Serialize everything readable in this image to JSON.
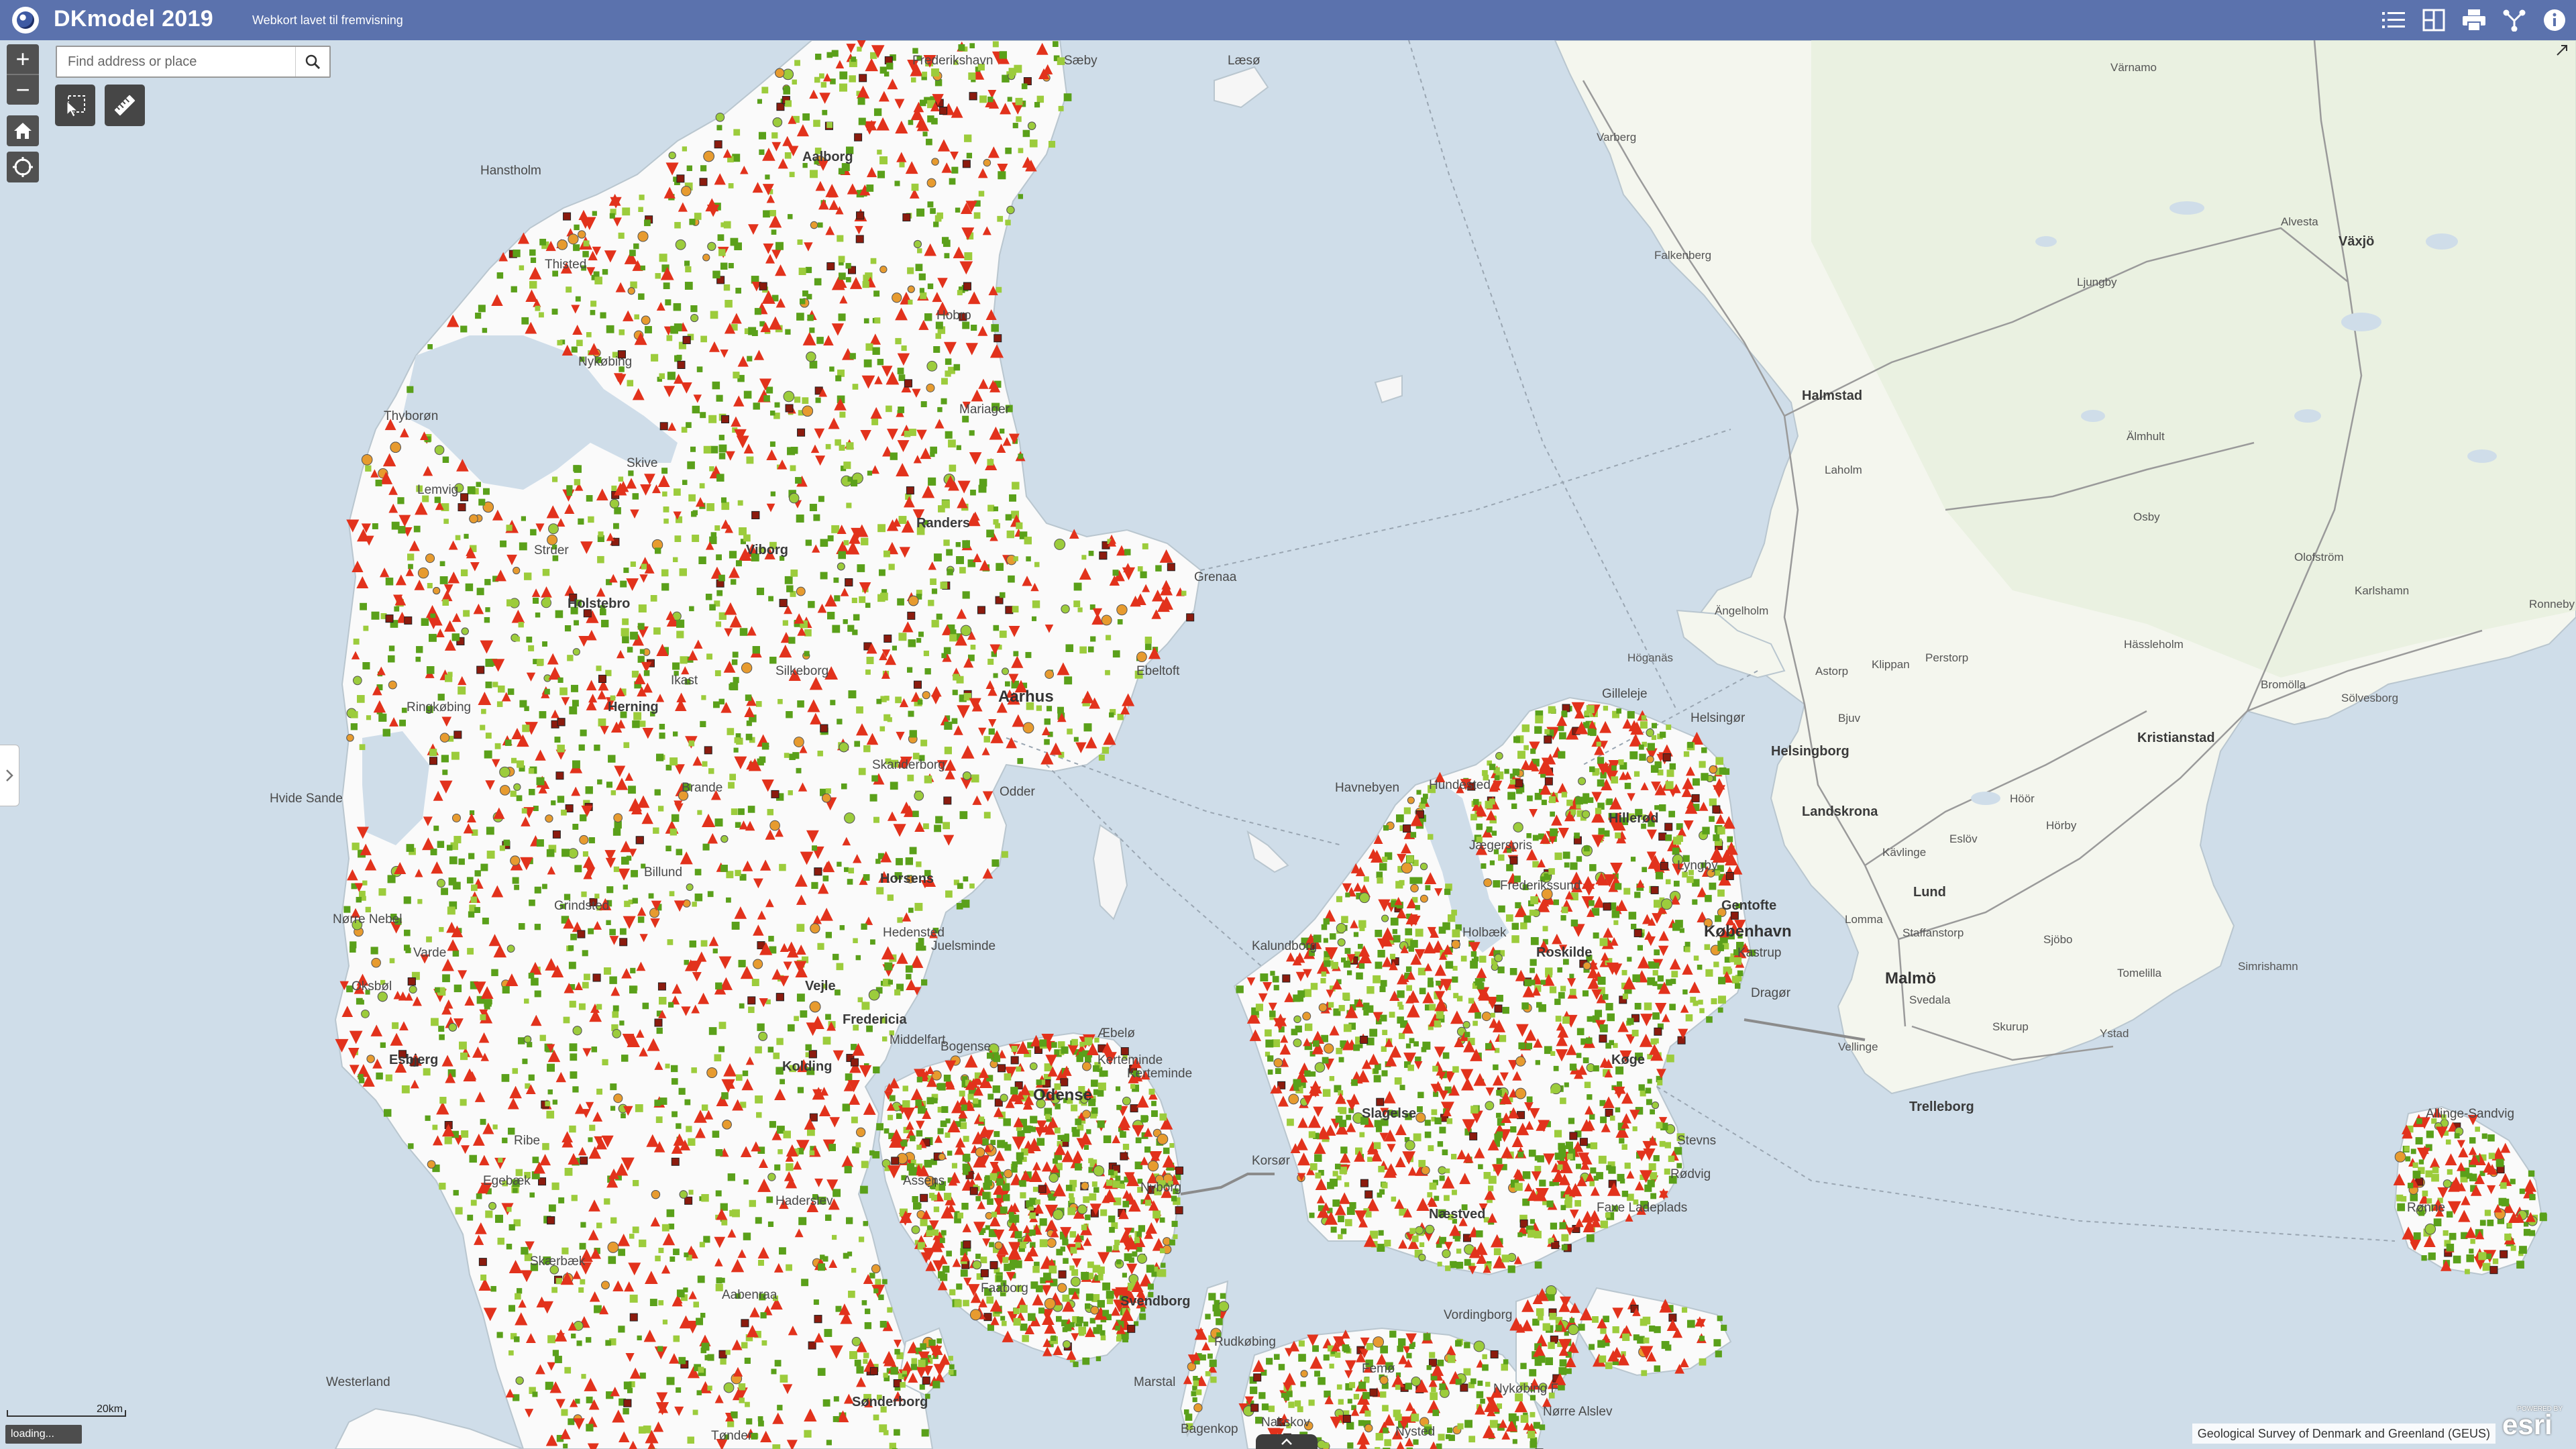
{
  "header": {
    "title": "DKmodel 2019",
    "subtitle": "Webkort lavet til fremvisning"
  },
  "header_icons": [
    "layer-list-icon",
    "basemap-gallery-icon",
    "print-icon",
    "share-icon",
    "about-icon"
  ],
  "controls": {
    "zoom_in": "+",
    "zoom_out": "−",
    "home_icon": "home-icon",
    "locate_icon": "locate-icon"
  },
  "search": {
    "placeholder": "Find address or place",
    "value": ""
  },
  "tools": [
    "select-tool-icon",
    "measure-tool-icon"
  ],
  "scale": {
    "label": "20km"
  },
  "status": {
    "loading": "loading..."
  },
  "attribution": "Geological Survey of Denmark and Greenland (GEUS)",
  "esri": {
    "logo": "esri",
    "powered": "POWERED BY"
  },
  "colors": {
    "header": "#5b72ad",
    "water": "#cfdde9",
    "land": "#fafafa",
    "sweden_land": "#f4f6ef",
    "symbol_green": "#5aa01a",
    "symbol_lightgreen": "#9ccc3c",
    "symbol_red": "#e2321c",
    "symbol_darkred": "#8b1b0e",
    "symbol_orange": "#e79b2f"
  },
  "places": {
    "denmark": [
      "Hanstholm",
      "Thisted",
      "Nykøbing",
      "Thyborøn",
      "Lemvig",
      "Skive",
      "Randers",
      "Grenaa",
      "Viborg",
      "Silkeborg",
      "Aarhus",
      "Ebeltoft",
      "Hvide Sande",
      "Horsens",
      "Juelsminde",
      "Nørre Nebel",
      "Oksbøl",
      "Vejle",
      "Fredericia",
      "Kolding",
      "Esbjerg",
      "Middelfart",
      "Odense",
      "Kerteminde",
      "Nyborg",
      "Svendborg",
      "Faaborg",
      "Assens",
      "Haderslev",
      "Aabenraa",
      "Sønderborg",
      "Ribe",
      "Skærbæk",
      "Egebæk",
      "Westerland",
      "Tønder",
      "Korsør",
      "Slagelse",
      "Næstved",
      "Køge",
      "Holbæk",
      "Kalundborg",
      "Roskilde",
      "Hillerød",
      "Helsingør",
      "Gilleleje",
      "Hundested",
      "Havnebyen",
      "Jægerspris",
      "Frederikssund",
      "Lyngby",
      "Gentofte",
      "København",
      "Kastrup",
      "Dragør",
      "Stevns",
      "Faxe Ladeplads",
      "Rødvig",
      "Vordingborg",
      "Nykøbing F",
      "Marstal",
      "Rudkøbing",
      "Nakskov",
      "Rønne",
      "Allinge-Sandvig",
      "Sæby",
      "Frederikshavn",
      "Aalborg",
      "Hobro",
      "Mariager",
      "Struer",
      "Holstebro",
      "Herning",
      "Ringkøbing",
      "Ikast",
      "Brande",
      "Grindsted",
      "Billund",
      "Varde",
      "Odder",
      "Skanderborg",
      "Hedensted",
      "Bogense",
      "Kerteminde",
      "Nysted",
      "Nørre Alslev",
      "Femø",
      "Bagenkop",
      "Æbelø",
      "Læsø"
    ],
    "sweden": [
      "Varberg",
      "Falkenberg",
      "Halmstad",
      "Värnamo",
      "Ljungby",
      "Alvesta",
      "Växjö",
      "Laholm",
      "Älmhult",
      "Osby",
      "Olofström",
      "Karlshamn",
      "Ronneby",
      "Bromölla",
      "Sölvesborg",
      "Kristianstad",
      "Hässleholm",
      "Ängelholm",
      "Höganäs",
      "Helsingborg",
      "Landskrona",
      "Lund",
      "Malmö",
      "Staffanstorp",
      "Svedala",
      "Trelleborg",
      "Skurup",
      "Ystad",
      "Simrishamn",
      "Sjöbo",
      "Tomelilla",
      "Hörby",
      "Eslöv",
      "Kävlinge",
      "Lomma",
      "Höör",
      "Bjuv",
      "Astorp",
      "Klippan",
      "Perstorp",
      "Vellinge"
    ]
  },
  "legend_items": []
}
